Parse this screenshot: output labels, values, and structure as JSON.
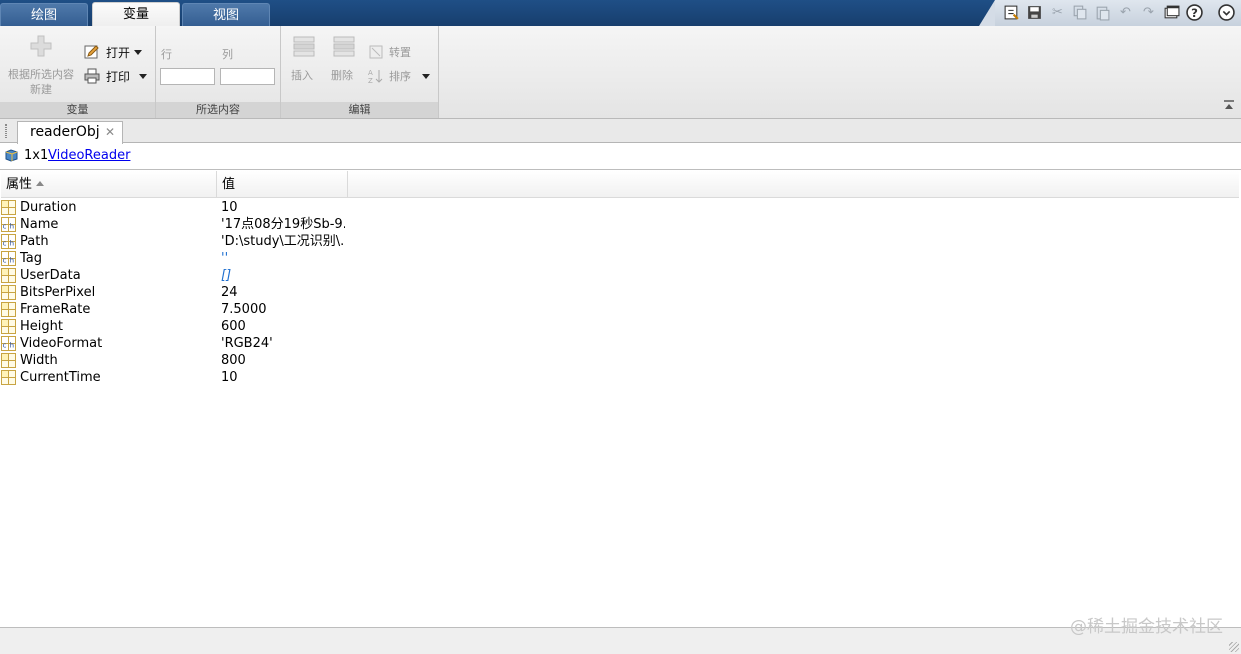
{
  "tabs": [
    {
      "label": "绘图",
      "active": false
    },
    {
      "label": "变量",
      "active": true
    },
    {
      "label": "视图",
      "active": false
    }
  ],
  "quick_access": [
    "layout-icon",
    "save-icon",
    "cut-icon",
    "copy-icon",
    "paste-icon",
    "undo-icon",
    "redo-icon",
    "window-switch-icon",
    "help-icon",
    "expand-icon"
  ],
  "ribbon": {
    "variable_group": {
      "new_from_selection": "根据所选内容\n新建",
      "new_line1": "根据所选内容",
      "new_line2": "新建",
      "open": "打开",
      "print": "打印",
      "label": "变量"
    },
    "selection_group": {
      "row_label": "行",
      "col_label": "列",
      "row_value": "",
      "col_value": "",
      "label": "所选内容"
    },
    "edit_group": {
      "insert": "插入",
      "delete": "删除",
      "transpose": "转置",
      "sort": "排序",
      "label": "编辑"
    }
  },
  "document_tab": {
    "label": "readerObj"
  },
  "summary": {
    "dims": "1x1",
    "class_name": "VideoReader"
  },
  "table": {
    "headers": [
      "属性",
      "值"
    ],
    "rows": [
      {
        "name": "Duration",
        "value": "10",
        "type": "numeric"
      },
      {
        "name": "Name",
        "value": "'17点08分19秒Sb-9....",
        "type": "char"
      },
      {
        "name": "Path",
        "value": "'D:\\study\\工况识别\\...",
        "type": "char"
      },
      {
        "name": "Tag",
        "value": "''",
        "type": "char"
      },
      {
        "name": "UserData",
        "value": "[]",
        "type": "numeric"
      },
      {
        "name": "BitsPerPixel",
        "value": "24",
        "type": "numeric"
      },
      {
        "name": "FrameRate",
        "value": "7.5000",
        "type": "numeric"
      },
      {
        "name": "Height",
        "value": "600",
        "type": "numeric"
      },
      {
        "name": "VideoFormat",
        "value": "'RGB24'",
        "type": "char"
      },
      {
        "name": "Width",
        "value": "800",
        "type": "numeric"
      },
      {
        "name": "CurrentTime",
        "value": "10",
        "type": "numeric"
      }
    ]
  },
  "watermark": "@稀土掘金技术社区"
}
